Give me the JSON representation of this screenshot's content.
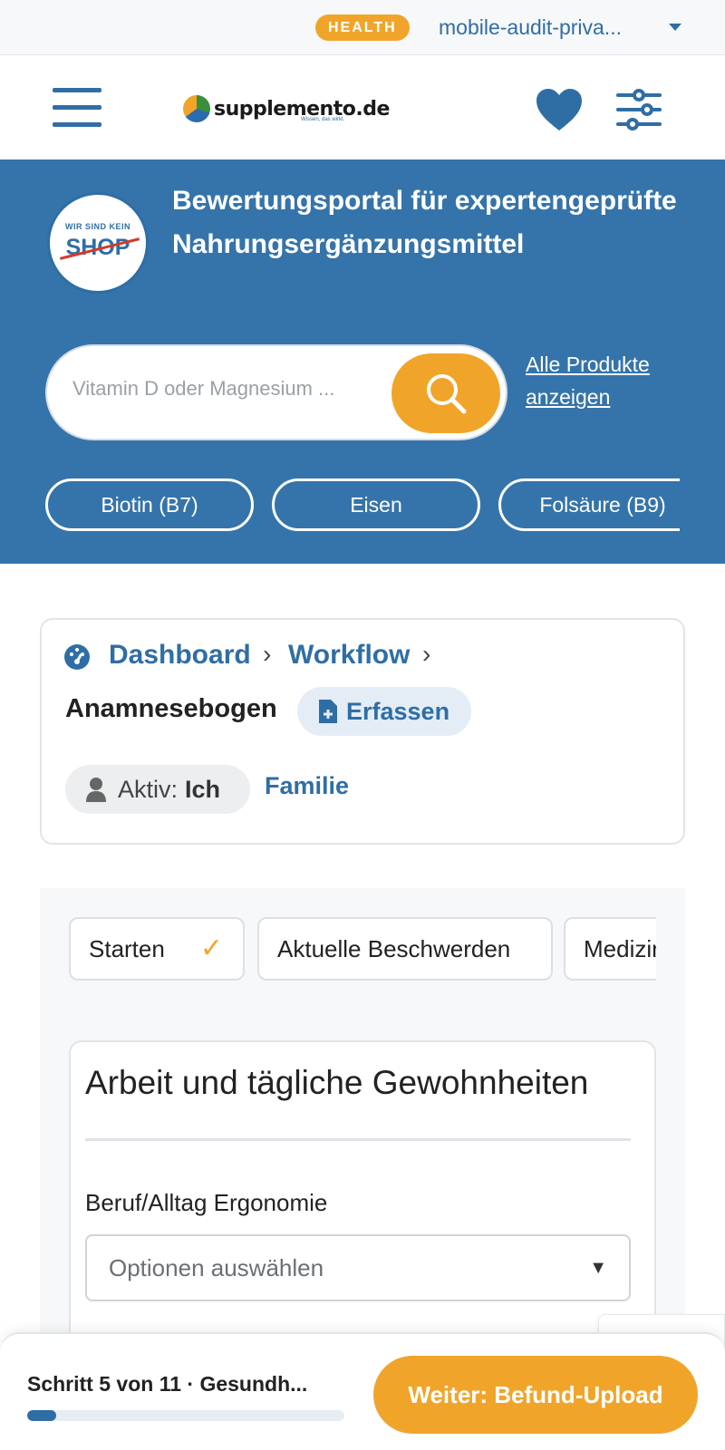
{
  "env": {
    "badge": "HEALTH",
    "name": "mobile-audit-priva..."
  },
  "header": {
    "logo_text": "supplemento.de",
    "logo_tagline": "Wissen, das wirkt."
  },
  "hero": {
    "shop_badge_top": "WIR SIND KEIN",
    "shop_badge_word": "SHOP",
    "title": "Bewertungsportal für expertengeprüfte Nahrungsergänzungsmittel",
    "search_placeholder": "Vitamin D oder Magnesium ...",
    "all_products": "Alle Produkte anzeigen",
    "chips": [
      "Biotin (B7)",
      "Eisen",
      "Folsäure (B9)"
    ]
  },
  "breadcrumb": {
    "dashboard": "Dashboard",
    "workflow": "Workflow",
    "separator": "›",
    "current": "Anamnesebogen",
    "action": "Erfassen",
    "active_label": "Aktiv:",
    "active_value": "Ich",
    "family": "Familie"
  },
  "steps": [
    {
      "label": "Starten",
      "done": true
    },
    {
      "label": "Aktuelle Beschwerden",
      "done": false
    },
    {
      "label": "Medizinische",
      "done": false
    }
  ],
  "step_check": "✓",
  "form": {
    "section_title": "Arbeit und tägliche Gewohnheiten",
    "field_label": "Beruf/Alltag Ergonomie",
    "select_placeholder": "Optionen auswählen",
    "select_arrow": "▼"
  },
  "footer": {
    "step_text": "Schritt 5 von 11 · Gesundh...",
    "progress": 0.09,
    "next_button": "Weiter: Befund-Upload"
  },
  "colors": {
    "brand_blue": "#3574aa",
    "link_blue": "#2f6ea5",
    "accent_orange": "#f0a52a"
  }
}
